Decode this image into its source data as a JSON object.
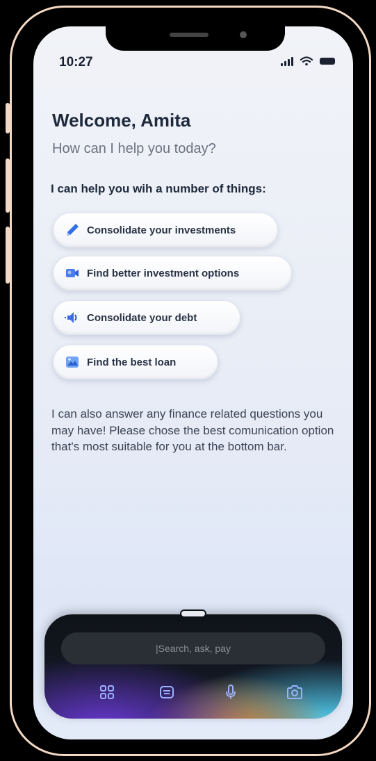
{
  "status_bar": {
    "time": "10:27"
  },
  "header": {
    "welcome": "Welcome, Amita",
    "subtitle": "How can I help you today?"
  },
  "suggestions": {
    "heading": "I can help you wih a number of things:",
    "items": [
      {
        "label": "Consolidate your investments",
        "icon": "pen-icon"
      },
      {
        "label": "Find better investment options",
        "icon": "video-camera-icon"
      },
      {
        "label": "Consolidate your debt",
        "icon": "speaker-icon"
      },
      {
        "label": "Find the best loan",
        "icon": "picture-icon"
      }
    ]
  },
  "info_text": "I can also answer any finance related questions you may have! Please chose the best comunication option that's most suitable for you at the bottom bar.",
  "bottom_bar": {
    "search_placeholder": "|Search, ask, pay",
    "icons": [
      "apps-grid-icon",
      "keyboard-icon",
      "microphone-icon",
      "camera-icon"
    ]
  },
  "colors": {
    "frame": "#f3d9c4",
    "text_dark": "#1e2a3c",
    "text_muted": "#6b7280",
    "bar_dark": "#0f1318",
    "bar_icon": "#9db2ff"
  }
}
